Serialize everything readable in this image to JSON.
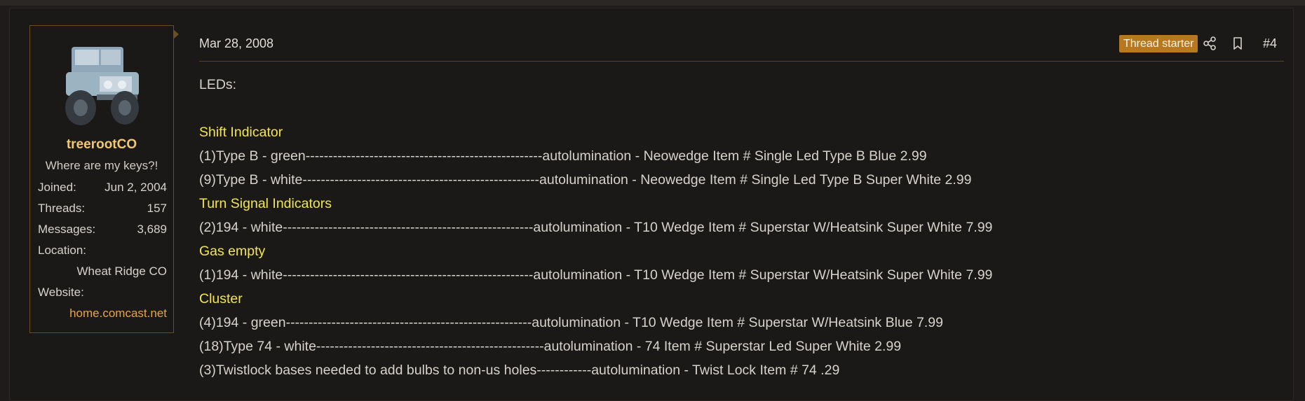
{
  "user": {
    "name": "treerootCO",
    "title": "Where are my keys?!",
    "stats": [
      {
        "key": "Joined:",
        "value": "Jun 2, 2004"
      },
      {
        "key": "Threads:",
        "value": "157"
      },
      {
        "key": "Messages:",
        "value": "3,689"
      }
    ],
    "location_label": "Location:",
    "location_value": "Wheat Ridge CO",
    "website_label": "Website:",
    "website_value": "home.comcast.net"
  },
  "post": {
    "date": "Mar 28, 2008",
    "badge": "Thread starter",
    "number": "#4",
    "icons": [
      "share-icon",
      "bookmark-icon"
    ],
    "colors": {
      "accent": "#b8781f",
      "heading": "#f2e64a",
      "link": "#e3a54a"
    },
    "lines": [
      {
        "text": "LEDs:",
        "kind": "text"
      },
      {
        "text": "",
        "kind": "blank"
      },
      {
        "text": "Shift Indicator",
        "kind": "heading"
      },
      {
        "text": "(1)Type B - green----------------------------------------------------autolumination - Neowedge Item # Single Led Type B Blue 2.99",
        "kind": "text"
      },
      {
        "text": "(9)Type B - white----------------------------------------------------autolumination - Neowedge Item # Single Led Type B Super White 2.99",
        "kind": "text"
      },
      {
        "text": "Turn Signal Indicators",
        "kind": "heading"
      },
      {
        "text": "(2)194 - white-------------------------------------------------------autolumination - T10 Wedge Item # Superstar W/Heatsink Super White 7.99",
        "kind": "text"
      },
      {
        "text": "Gas empty",
        "kind": "heading"
      },
      {
        "text": "(1)194 - white-------------------------------------------------------autolumination - T10 Wedge Item # Superstar W/Heatsink Super White 7.99",
        "kind": "text"
      },
      {
        "text": "Cluster",
        "kind": "heading"
      },
      {
        "text": "(4)194 - green------------------------------------------------------autolumination - T10 Wedge Item # Superstar W/Heatsink Blue 7.99",
        "kind": "text"
      },
      {
        "text": "(18)Type 74 - white--------------------------------------------------autolumination - 74 Item # Superstar Led Super White 2.99",
        "kind": "text"
      },
      {
        "text": "(3)Twistlock bases needed to add bulbs to non-us holes------------autolumination - Twist Lock Item # 74 .29",
        "kind": "text"
      }
    ]
  }
}
